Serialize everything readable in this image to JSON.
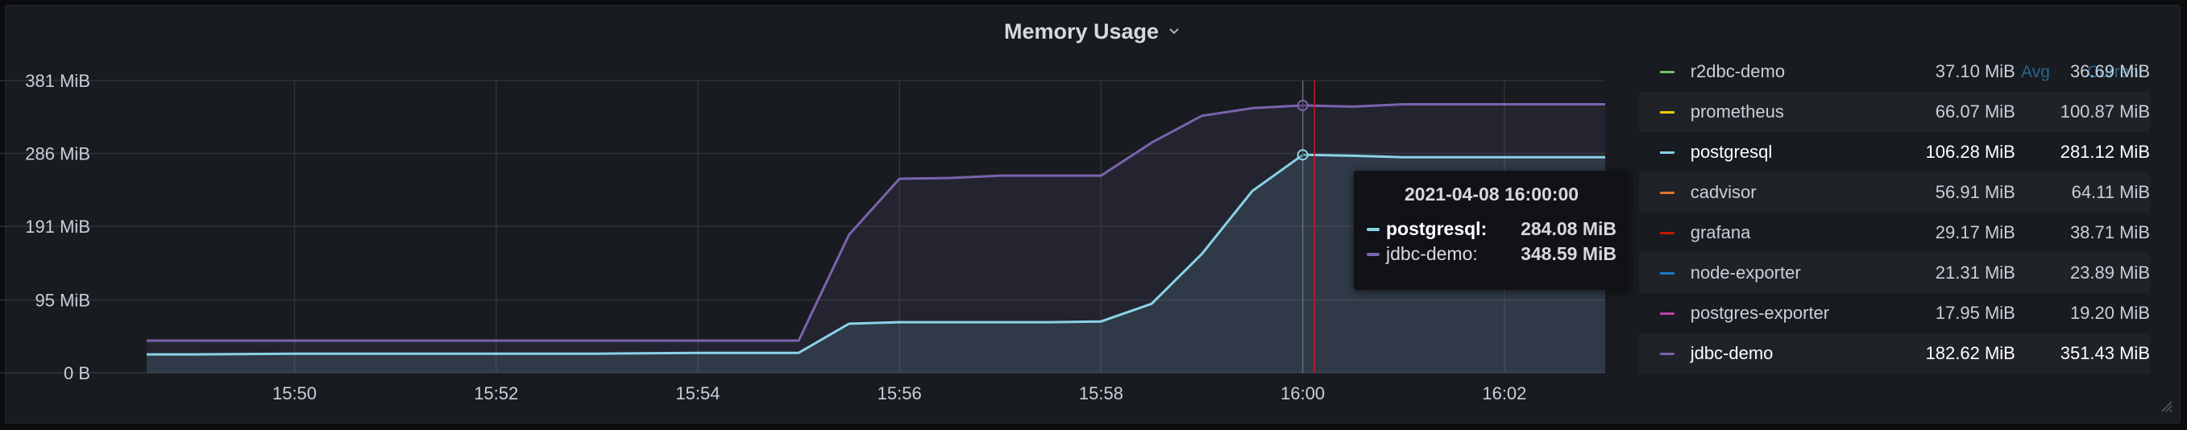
{
  "panel": {
    "title": "Memory Usage"
  },
  "tooltip": {
    "time": "2021-04-08 16:00:00",
    "rows": [
      {
        "name": "postgresql:",
        "value": "284.08 MiB",
        "color": "#8ad3e7",
        "highlight": true
      },
      {
        "name": "jdbc-demo:",
        "value": "348.59 MiB",
        "color": "#7b63ad",
        "highlight": false
      }
    ]
  },
  "legend": {
    "header": [
      "Avg",
      "Current"
    ],
    "rows": [
      {
        "name": "r2dbc-demo",
        "mean": "37.10 MiB",
        "max": "36.69 MiB",
        "color": "#73bf69"
      },
      {
        "name": "prometheus",
        "mean": "66.07 MiB",
        "max": "100.87 MiB",
        "color": "#f2cc0c"
      },
      {
        "name": "postgresql",
        "mean": "106.28 MiB",
        "max": "281.12 MiB",
        "color": "#8ad3e7",
        "bold": true
      },
      {
        "name": "cadvisor",
        "mean": "56.91 MiB",
        "max": "64.11 MiB",
        "color": "#e0752d"
      },
      {
        "name": "grafana",
        "mean": "29.17 MiB",
        "max": "38.71 MiB",
        "color": "#bf1b00"
      },
      {
        "name": "node-exporter",
        "mean": "21.31 MiB",
        "max": "23.89 MiB",
        "color": "#1f78c1"
      },
      {
        "name": "postgres-exporter",
        "mean": "17.95 MiB",
        "max": "19.20 MiB",
        "color": "#ba43a9"
      },
      {
        "name": "jdbc-demo",
        "mean": "182.62 MiB",
        "max": "351.43 MiB",
        "color": "#7b63ad",
        "bold": true
      }
    ]
  },
  "chart_data": {
    "type": "area",
    "title": "Memory Usage",
    "x_unit": "minutes",
    "xlim": [
      "15:48:32",
      "16:03:00"
    ],
    "ylim": [
      0,
      381
    ],
    "yticks": [
      {
        "value": 0,
        "label": "0 B"
      },
      {
        "value": 95,
        "label": "95 MiB"
      },
      {
        "value": 191,
        "label": "191 MiB"
      },
      {
        "value": 286,
        "label": "286 MiB"
      },
      {
        "value": 381,
        "label": "381 MiB"
      }
    ],
    "xticks": [
      "15:50",
      "15:52",
      "15:54",
      "15:56",
      "15:58",
      "16:00",
      "16:02"
    ],
    "grid": true,
    "legend_position": "right",
    "cursor_x": "16:00:00",
    "now_marker_x": "16:00:07",
    "series": [
      {
        "name": "jdbc-demo",
        "color": "#7b63ad",
        "x": [
          "15:48:32",
          "15:49:00",
          "15:50:00",
          "15:51:00",
          "15:52:00",
          "15:53:00",
          "15:54:00",
          "15:55:00",
          "15:55:30",
          "15:56:00",
          "15:56:30",
          "15:57:00",
          "15:57:30",
          "15:58:00",
          "15:58:30",
          "15:59:00",
          "15:59:30",
          "16:00:00",
          "16:00:30",
          "16:01:00",
          "16:01:30",
          "16:02:00",
          "16:02:30",
          "16:03:00"
        ],
        "y": [
          42,
          42,
          42,
          42,
          42,
          42,
          42,
          42,
          180,
          253,
          254,
          257,
          257,
          257,
          300,
          335,
          345,
          348.59,
          347,
          350,
          350,
          350,
          350,
          350
        ]
      },
      {
        "name": "postgresql",
        "color": "#8ad3e7",
        "x": [
          "15:48:32",
          "15:49:00",
          "15:50:00",
          "15:51:00",
          "15:52:00",
          "15:53:00",
          "15:54:00",
          "15:55:00",
          "15:55:30",
          "15:56:00",
          "15:56:30",
          "15:57:00",
          "15:57:30",
          "15:58:00",
          "15:58:30",
          "15:59:00",
          "15:59:30",
          "16:00:00",
          "16:00:30",
          "16:01:00",
          "16:01:30",
          "16:02:00",
          "16:02:30",
          "16:03:00"
        ],
        "y": [
          24,
          24,
          25,
          25,
          25,
          25,
          26,
          26,
          64,
          66,
          66,
          66,
          66,
          67,
          90,
          155,
          237,
          284.08,
          283,
          281,
          281,
          281,
          281,
          281
        ]
      }
    ]
  }
}
